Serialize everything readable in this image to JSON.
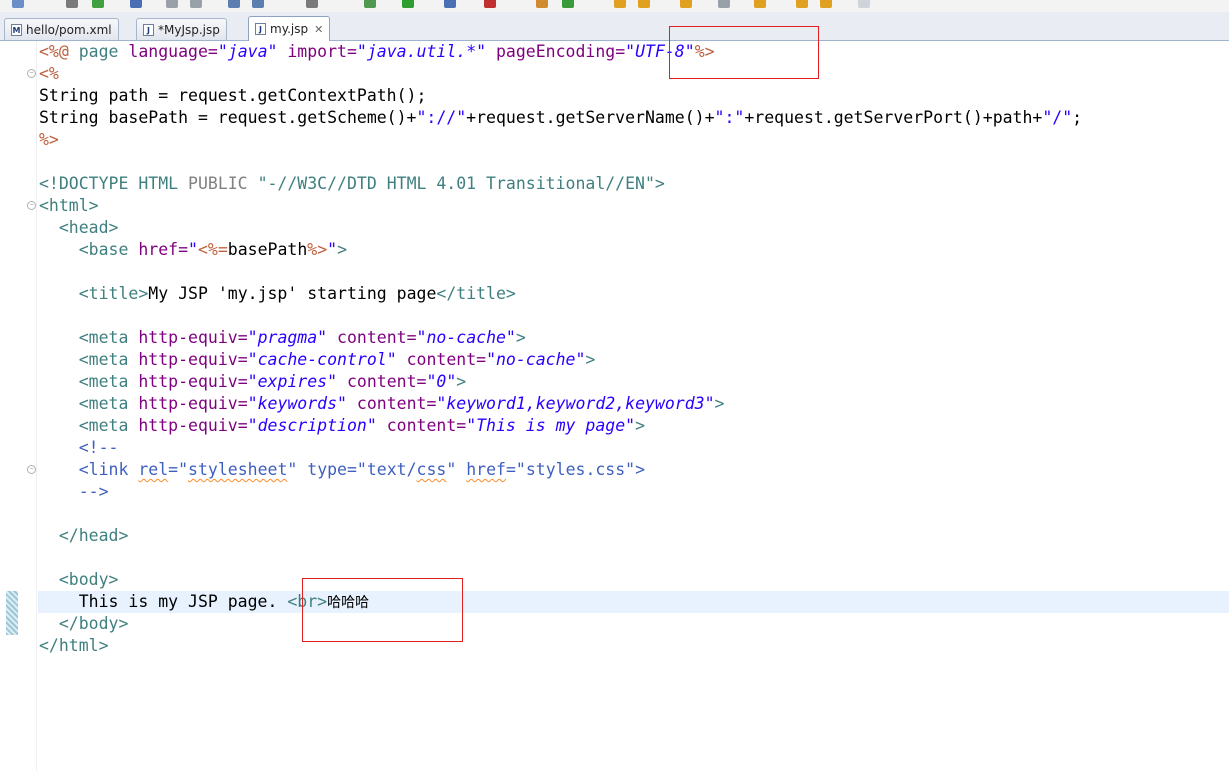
{
  "tabs": [
    {
      "label": "hello/pom.xml",
      "icon": "maven-file-icon",
      "icon_glyph": "M",
      "active": false
    },
    {
      "label": "*MyJsp.jsp",
      "icon": "jsp-file-icon",
      "icon_glyph": "J",
      "active": false
    },
    {
      "label": "my.jsp",
      "icon": "jsp-file-icon",
      "icon_glyph": "J",
      "active": true,
      "close": "✕"
    }
  ],
  "editor": {
    "lines": [
      [
        {
          "t": "<%@ ",
          "c": "jsp"
        },
        {
          "t": "page ",
          "c": "tag"
        },
        {
          "t": "language=",
          "c": "attr"
        },
        {
          "t": "\"java\"",
          "c": "val"
        },
        {
          "t": " import=",
          "c": "attr"
        },
        {
          "t": "\"java.util.*\"",
          "c": "val"
        },
        {
          "t": " pageEncoding=",
          "c": "attr"
        },
        {
          "t": "\"UTF-8\"",
          "c": "val"
        },
        {
          "t": "%>",
          "c": "jsp"
        }
      ],
      [
        {
          "t": "<%",
          "c": "jsp"
        }
      ],
      [
        {
          "t": "String path = request.getContextPath();",
          "c": "text"
        }
      ],
      [
        {
          "t": "String basePath = request.getScheme()+",
          "c": "text"
        },
        {
          "t": "\"://\"",
          "c": "str"
        },
        {
          "t": "+request.getServerName()+",
          "c": "text"
        },
        {
          "t": "\":\"",
          "c": "str"
        },
        {
          "t": "+request.getServerPort()+path+",
          "c": "text"
        },
        {
          "t": "\"/\"",
          "c": "str"
        },
        {
          "t": ";",
          "c": "text"
        }
      ],
      [
        {
          "t": "%>",
          "c": "jsp"
        }
      ],
      [],
      [
        {
          "t": "<!DOCTYPE ",
          "c": "doct"
        },
        {
          "t": "HTML ",
          "c": "doct"
        },
        {
          "t": "PUBLIC ",
          "c": "doctn"
        },
        {
          "t": "\"-//W3C//DTD HTML 4.01 Transitional//EN\"",
          "c": "doct"
        },
        {
          "t": ">",
          "c": "doct"
        }
      ],
      [
        {
          "t": "<html>",
          "c": "tag"
        }
      ],
      [
        {
          "t": "  ",
          "c": "text"
        },
        {
          "t": "<head>",
          "c": "tag"
        }
      ],
      [
        {
          "t": "    ",
          "c": "text"
        },
        {
          "t": "<base ",
          "c": "tag"
        },
        {
          "t": "href=",
          "c": "attr"
        },
        {
          "t": "\"",
          "c": "valn"
        },
        {
          "t": "<%=",
          "c": "jsp"
        },
        {
          "t": "basePath",
          "c": "text"
        },
        {
          "t": "%>",
          "c": "jsp"
        },
        {
          "t": "\"",
          "c": "valn"
        },
        {
          "t": ">",
          "c": "tag"
        }
      ],
      [],
      [
        {
          "t": "    ",
          "c": "text"
        },
        {
          "t": "<title>",
          "c": "tag"
        },
        {
          "t": "My JSP 'my.jsp' starting page",
          "c": "text"
        },
        {
          "t": "</title>",
          "c": "tag"
        }
      ],
      [],
      [
        {
          "t": "    ",
          "c": "text"
        },
        {
          "t": "<meta ",
          "c": "tag"
        },
        {
          "t": "http-equiv=",
          "c": "attr"
        },
        {
          "t": "\"pragma\"",
          "c": "val"
        },
        {
          "t": " content=",
          "c": "attr"
        },
        {
          "t": "\"no-cache\"",
          "c": "val"
        },
        {
          "t": ">",
          "c": "tag"
        }
      ],
      [
        {
          "t": "    ",
          "c": "text"
        },
        {
          "t": "<meta ",
          "c": "tag"
        },
        {
          "t": "http-equiv=",
          "c": "attr"
        },
        {
          "t": "\"cache-control\"",
          "c": "val"
        },
        {
          "t": " content=",
          "c": "attr"
        },
        {
          "t": "\"no-cache\"",
          "c": "val"
        },
        {
          "t": ">",
          "c": "tag"
        }
      ],
      [
        {
          "t": "    ",
          "c": "text"
        },
        {
          "t": "<meta ",
          "c": "tag"
        },
        {
          "t": "http-equiv=",
          "c": "attr"
        },
        {
          "t": "\"expires\"",
          "c": "val"
        },
        {
          "t": " content=",
          "c": "attr"
        },
        {
          "t": "\"0\"",
          "c": "val"
        },
        {
          "t": ">",
          "c": "tag"
        }
      ],
      [
        {
          "t": "    ",
          "c": "text"
        },
        {
          "t": "<meta ",
          "c": "tag"
        },
        {
          "t": "http-equiv=",
          "c": "attr"
        },
        {
          "t": "\"keywords\"",
          "c": "val"
        },
        {
          "t": " content=",
          "c": "attr"
        },
        {
          "t": "\"keyword1,keyword2,keyword3\"",
          "c": "val"
        },
        {
          "t": ">",
          "c": "tag"
        }
      ],
      [
        {
          "t": "    ",
          "c": "text"
        },
        {
          "t": "<meta ",
          "c": "tag"
        },
        {
          "t": "http-equiv=",
          "c": "attr"
        },
        {
          "t": "\"description\"",
          "c": "val"
        },
        {
          "t": " content=",
          "c": "attr"
        },
        {
          "t": "\"This is my page\"",
          "c": "val"
        },
        {
          "t": ">",
          "c": "tag"
        }
      ],
      [
        {
          "t": "    ",
          "c": "text"
        },
        {
          "t": "<!--",
          "c": "cm"
        }
      ],
      [
        {
          "t": "    ",
          "c": "text"
        },
        {
          "t": "<link ",
          "c": "cm"
        },
        {
          "t": "rel",
          "c": "cm",
          "w": 1
        },
        {
          "t": "=\"",
          "c": "cm"
        },
        {
          "t": "stylesheet",
          "c": "cm",
          "w": 1
        },
        {
          "t": "\" type=\"text/",
          "c": "cm"
        },
        {
          "t": "css",
          "c": "cm",
          "w": 1
        },
        {
          "t": "\" ",
          "c": "cm"
        },
        {
          "t": "href",
          "c": "cm",
          "w": 1
        },
        {
          "t": "=\"styles.css\">",
          "c": "cm"
        }
      ],
      [
        {
          "t": "    ",
          "c": "text"
        },
        {
          "t": "-->",
          "c": "cm"
        }
      ],
      [],
      [
        {
          "t": "  ",
          "c": "text"
        },
        {
          "t": "</head>",
          "c": "tag"
        }
      ],
      [],
      [
        {
          "t": "  ",
          "c": "text"
        },
        {
          "t": "<body>",
          "c": "tag"
        }
      ],
      [
        {
          "t": "    This is my JSP page. ",
          "c": "text"
        },
        {
          "t": "<br>",
          "c": "tag"
        },
        {
          "t": "哈哈哈",
          "c": "cjk"
        }
      ],
      [
        {
          "t": "  ",
          "c": "text"
        },
        {
          "t": "</body>",
          "c": "tag"
        }
      ],
      [
        {
          "t": "</html>",
          "c": "tag"
        }
      ]
    ],
    "fold_lines": [
      1,
      7,
      19
    ],
    "current_line": 25
  },
  "colors": {
    "tag": "#3f7f7f",
    "attribute": "#7f007f",
    "value": "#2a00ff",
    "jsp_delimiter": "#bf5f3f",
    "comment": "#3f5fbf",
    "annotation_box": "#e02020",
    "current_line_bg": "#e8f2fe"
  }
}
